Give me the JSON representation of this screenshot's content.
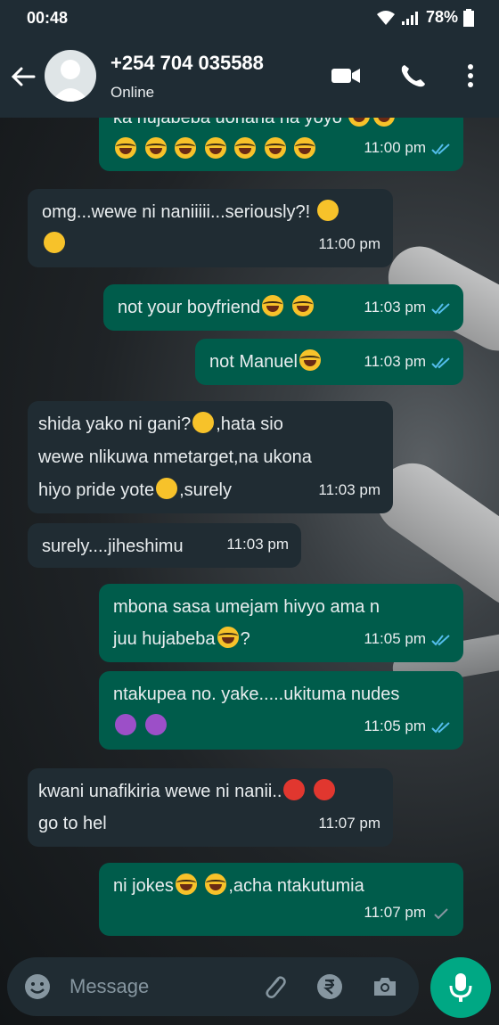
{
  "status_bar": {
    "time": "00:48",
    "battery": "78%"
  },
  "header": {
    "contact": "+254 704 035588",
    "status": "Online"
  },
  "messages": [
    {
      "dir": "out",
      "lines": [
        "ka hujabeba uonana na yoyo"
      ],
      "time": "11:00 pm",
      "ticks": "read"
    },
    {
      "dir": "in",
      "lines": [
        "omg...wewe ni naniiiii...seriously?!"
      ],
      "time": "11:00 pm"
    },
    {
      "dir": "out",
      "lines": [
        "not your boyfriend"
      ],
      "time": "11:03 pm",
      "ticks": "read"
    },
    {
      "dir": "out",
      "lines": [
        "not Manuel"
      ],
      "time": "11:03 pm",
      "ticks": "read"
    },
    {
      "dir": "in",
      "lines": [
        "shida yako ni gani?",
        ",hata sio",
        "wewe nlikuwa nmetarget,na ukona",
        "hiyo pride yote",
        ",surely"
      ],
      "time": "11:03 pm"
    },
    {
      "dir": "in",
      "lines": [
        "surely....jiheshimu"
      ],
      "time": "11:03 pm"
    },
    {
      "dir": "out",
      "lines": [
        "mbona sasa umejam hivyo ama n",
        "juu hujabeba",
        "?"
      ],
      "time": "11:05 pm",
      "ticks": "read"
    },
    {
      "dir": "out",
      "lines": [
        "ntakupea no. yake.....ukituma nudes"
      ],
      "time": "11:05 pm",
      "ticks": "read"
    },
    {
      "dir": "in",
      "lines": [
        "kwani unafikiria wewe ni nanii..",
        "go to hel"
      ],
      "time": "11:07 pm"
    },
    {
      "dir": "out",
      "lines": [
        "ni jokes",
        ",acha ntakutumia"
      ],
      "time": "11:07 pm",
      "ticks": "sent"
    }
  ],
  "input": {
    "placeholder": "Message"
  },
  "colors": {
    "outgoing": "#005c4b",
    "incoming": "#202c33",
    "accent": "#00a884",
    "read_ticks": "#53bdeb"
  },
  "icons": [
    "back-arrow-icon",
    "video-call-icon",
    "voice-call-icon",
    "more-options-icon",
    "emoji-icon",
    "attach-icon",
    "rupee-payment-icon",
    "camera-icon",
    "mic-icon"
  ]
}
